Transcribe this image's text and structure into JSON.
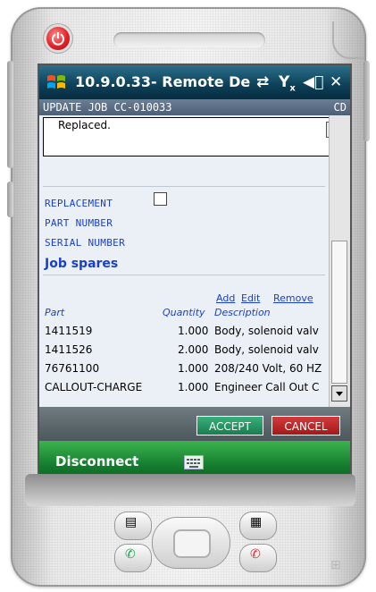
{
  "window": {
    "title": "10.9.0.33- Remote De"
  },
  "form": {
    "header_left": "UPDATE JOB CC-010033",
    "header_right": "CD",
    "notes_text": "Replaced."
  },
  "fields": {
    "replacement": "REPLACEMENT",
    "part_number": "PART NUMBER",
    "serial_number": "SERIAL NUMBER"
  },
  "section": {
    "title": "Job spares"
  },
  "actions": {
    "add": "Add",
    "edit": "Edit",
    "remove": "Remove"
  },
  "table": {
    "headers": {
      "part": "Part",
      "quantity": "Quantity",
      "description": "Description"
    },
    "rows": [
      {
        "part": "1411519",
        "quantity": "1.000",
        "description": "Body, solenoid valv"
      },
      {
        "part": "1411526",
        "quantity": "2.000",
        "description": "Body, solenoid valv"
      },
      {
        "part": "76761100",
        "quantity": "1.000",
        "description": "208/240 Volt, 60 HZ"
      },
      {
        "part": "CALLOUT-CHARGE",
        "quantity": "1.000",
        "description": "Engineer Call Out C"
      }
    ]
  },
  "buttons": {
    "accept": "ACCEPT",
    "cancel": "CANCEL"
  },
  "softkey": {
    "label": "Disconnect"
  },
  "colors": {
    "link": "#1a3ed0",
    "accept": "#1a7d4f",
    "cancel": "#a11a1a",
    "softbar": "#137a2d"
  }
}
